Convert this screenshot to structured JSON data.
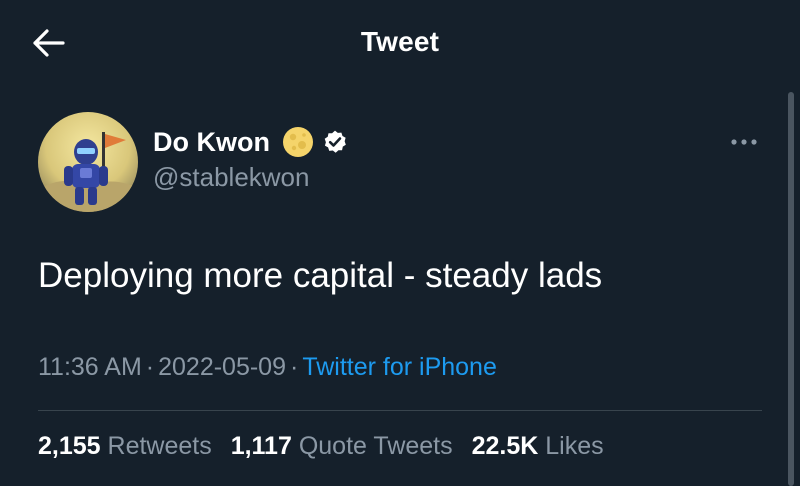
{
  "header": {
    "title": "Tweet",
    "back_icon": "arrow-left-icon"
  },
  "author": {
    "display_name": "Do Kwon",
    "handle": "@stablekwon",
    "emoji": "full-moon-icon",
    "verified": true,
    "verified_icon": "verified-badge-icon"
  },
  "tweet": {
    "text": "Deploying more capital - steady lads",
    "time": "11:36 AM",
    "date": "2022-05-09",
    "separator": "·",
    "source": "Twitter for iPhone"
  },
  "stats": {
    "retweets_count": "2,155",
    "retweets_label": "Retweets",
    "quotes_count": "1,117",
    "quotes_label": "Quote Tweets",
    "likes_count": "22.5K",
    "likes_label": "Likes"
  },
  "colors": {
    "background": "#15202b",
    "text": "#ffffff",
    "muted": "#8b98a5",
    "link": "#1d9bf0",
    "divider": "#38444d"
  }
}
